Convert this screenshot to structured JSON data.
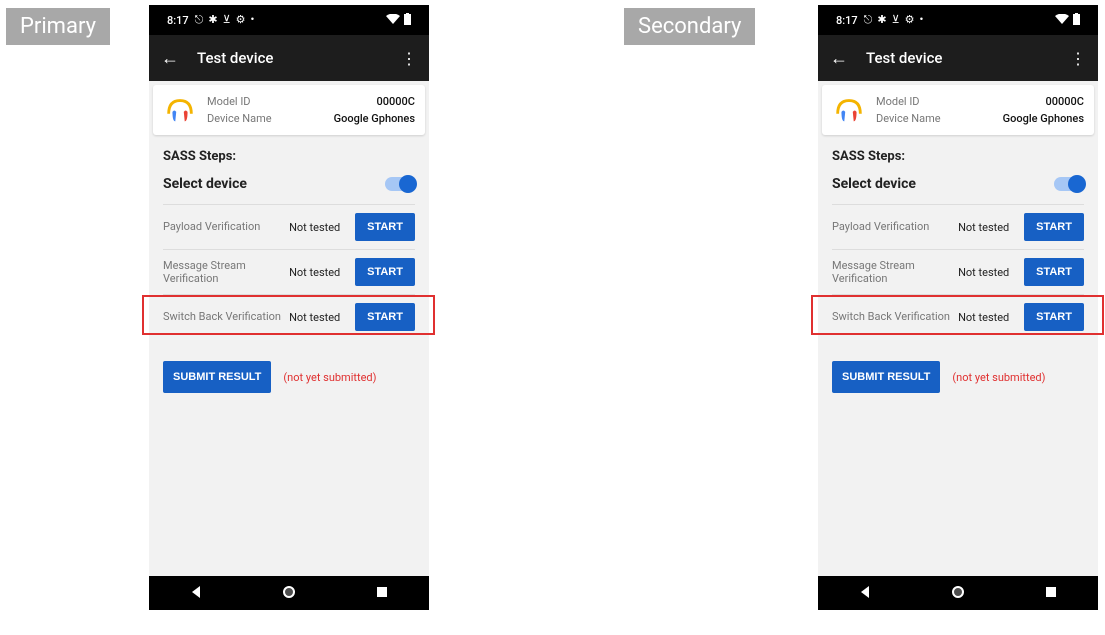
{
  "labels": {
    "primary": "Primary",
    "secondary": "Secondary"
  },
  "status": {
    "time": "8:17",
    "icons": [
      "⎋",
      "✱",
      "⊻",
      "⚙",
      "•"
    ]
  },
  "appbar": {
    "title": "Test device"
  },
  "card": {
    "model_label": "Model ID",
    "model_value": "00000C",
    "device_label": "Device Name",
    "device_value": "Google Gphones"
  },
  "sass": {
    "title": "SASS Steps:",
    "select_label": "Select device",
    "steps": [
      {
        "name": "Payload Verification",
        "status": "Not tested",
        "button": "START"
      },
      {
        "name": "Message Stream Verification",
        "status": "Not tested",
        "button": "START"
      },
      {
        "name": "Switch Back Verification",
        "status": "Not tested",
        "button": "START"
      }
    ]
  },
  "submit": {
    "button": "SUBMIT RESULT",
    "note": "(not yet submitted)"
  }
}
